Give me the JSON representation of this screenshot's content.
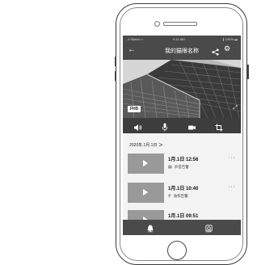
{
  "status_bar": {
    "carrier": "..ıl Sketch ≈",
    "time": "9:41 AM",
    "battery": "∦ 100% ▬"
  },
  "header": {
    "title": "我的猫眼名称",
    "back_icon": "arrow-left-icon",
    "share_icon": "share-icon",
    "settings_icon": "gear-icon"
  },
  "video": {
    "quality_badge": "FHD",
    "fullscreen_icon": "fullscreen-icon"
  },
  "controls": [
    {
      "icon": "speaker-icon"
    },
    {
      "icon": "microphone-icon"
    },
    {
      "icon": "video-record-icon"
    },
    {
      "icon": "crop-icon"
    }
  ],
  "records": {
    "date": "2020年.1月.1日",
    "items": [
      {
        "time": "1月.1日 12:56",
        "tag": "声音告警",
        "tag_icon": "sound-alert-icon"
      },
      {
        "time": "1月.1日 10:40",
        "tag": "动作告警",
        "tag_icon": "motion-alert-icon"
      },
      {
        "time": "1月.1日 09:51",
        "tag": "",
        "tag_icon": ""
      }
    ]
  },
  "bottom_nav": {
    "tabs": [
      {
        "label": "消息",
        "icon": "bell-icon"
      },
      {
        "label": "回放",
        "icon": "playback-icon"
      }
    ]
  }
}
